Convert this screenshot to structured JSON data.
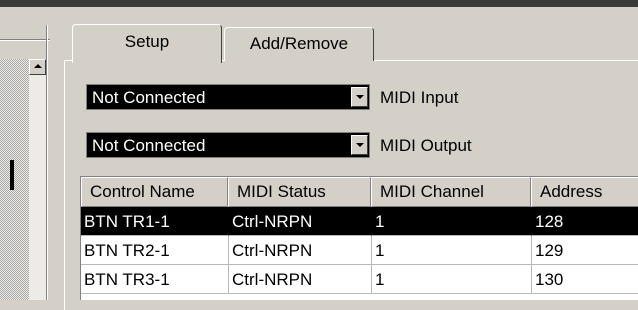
{
  "tabs": [
    {
      "label": "Setup"
    },
    {
      "label": "Add/Remove"
    }
  ],
  "midi_input": {
    "value": "Not Connected",
    "label": "MIDI Input"
  },
  "midi_output": {
    "value": "Not Connected",
    "label": "MIDI Output"
  },
  "table": {
    "columns": [
      "Control Name",
      "MIDI Status",
      "MIDI Channel",
      "Address"
    ],
    "rows": [
      [
        "BTN TR1-1",
        "Ctrl-NRPN",
        "1",
        "128"
      ],
      [
        "BTN TR2-1",
        "Ctrl-NRPN",
        "1",
        "129"
      ],
      [
        "BTN TR3-1",
        "Ctrl-NRPN",
        "1",
        "130"
      ]
    ],
    "selected_row": 0
  },
  "colors": {
    "window_face": "#d4d0c8",
    "selection": "#000000",
    "selection_text": "#ffffff"
  }
}
